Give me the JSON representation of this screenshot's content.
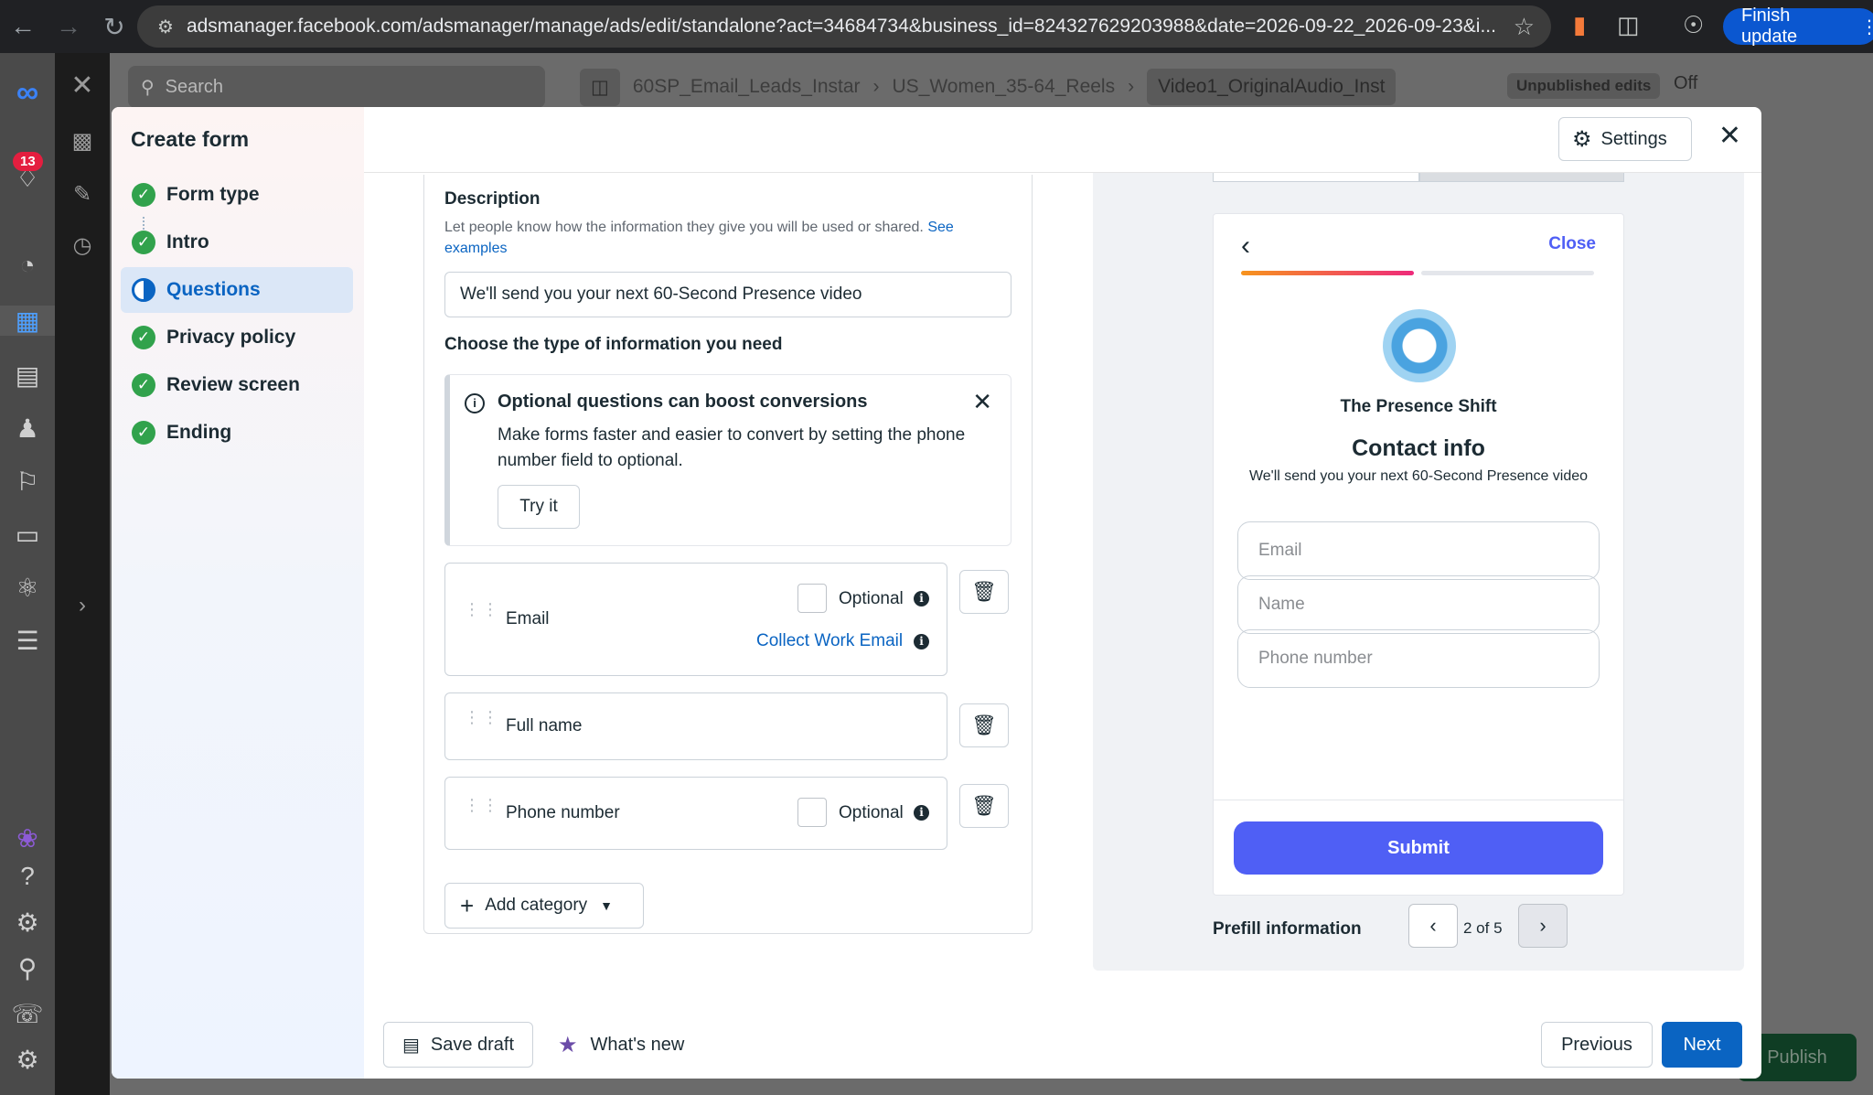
{
  "browser": {
    "url": "adsmanager.facebook.com/adsmanager/manage/ads/edit/standalone?act=34684734&business_id=824327629203988&date=2026-09-22_2026-09-23&i...",
    "finish_update": "Finish update"
  },
  "app": {
    "search_placeholder": "Search",
    "notifications_count": "13",
    "breadcrumb": [
      "60SP_Email_Leads_Instar",
      "US_Women_35-64_Reels",
      "Video1_OriginalAudio_Inst"
    ],
    "unpublished": "Unpublished edits",
    "toggle_label": "Off",
    "publish": "Publish"
  },
  "modal": {
    "title": "Create form",
    "settings_label": "Settings",
    "steps": [
      {
        "label": "Form type",
        "status": "done"
      },
      {
        "label": "Intro",
        "status": "done"
      },
      {
        "label": "Questions",
        "status": "active"
      },
      {
        "label": "Privacy policy",
        "status": "done"
      },
      {
        "label": "Review screen",
        "status": "done"
      },
      {
        "label": "Ending",
        "status": "done"
      }
    ]
  },
  "editor": {
    "description_title": "Description",
    "description_help": "Let people know how the information they give you will be used or shared.",
    "description_link": "See examples",
    "description_value": "We'll send you your next 60-Second Presence video",
    "info_type_title": "Choose the type of information you need",
    "tip": {
      "title": "Optional questions can boost conversions",
      "body": "Make forms faster and easier to convert by setting the phone number field to optional.",
      "button": "Try it"
    },
    "questions": [
      {
        "label": "Email",
        "optional_label": "Optional",
        "extra_link": "Collect Work Email"
      },
      {
        "label": "Full name"
      },
      {
        "label": "Phone number",
        "optional_label": "Optional"
      }
    ],
    "add_category": "Add category"
  },
  "preview": {
    "close_label": "Close",
    "brand": "The Presence Shift",
    "title": "Contact info",
    "subtitle": "We'll send you your next 60-Second Presence video",
    "fields": [
      "Email",
      "Name",
      "Phone number"
    ],
    "submit": "Submit",
    "prefill_label": "Prefill information",
    "page_indicator": "2 of 5"
  },
  "footer": {
    "save_draft": "Save draft",
    "whats_new": "What's new",
    "previous": "Previous",
    "next": "Next"
  },
  "colors": {
    "primary": "#0a64c2",
    "preview_accent": "#4f5ff5",
    "success": "#31a24c"
  }
}
